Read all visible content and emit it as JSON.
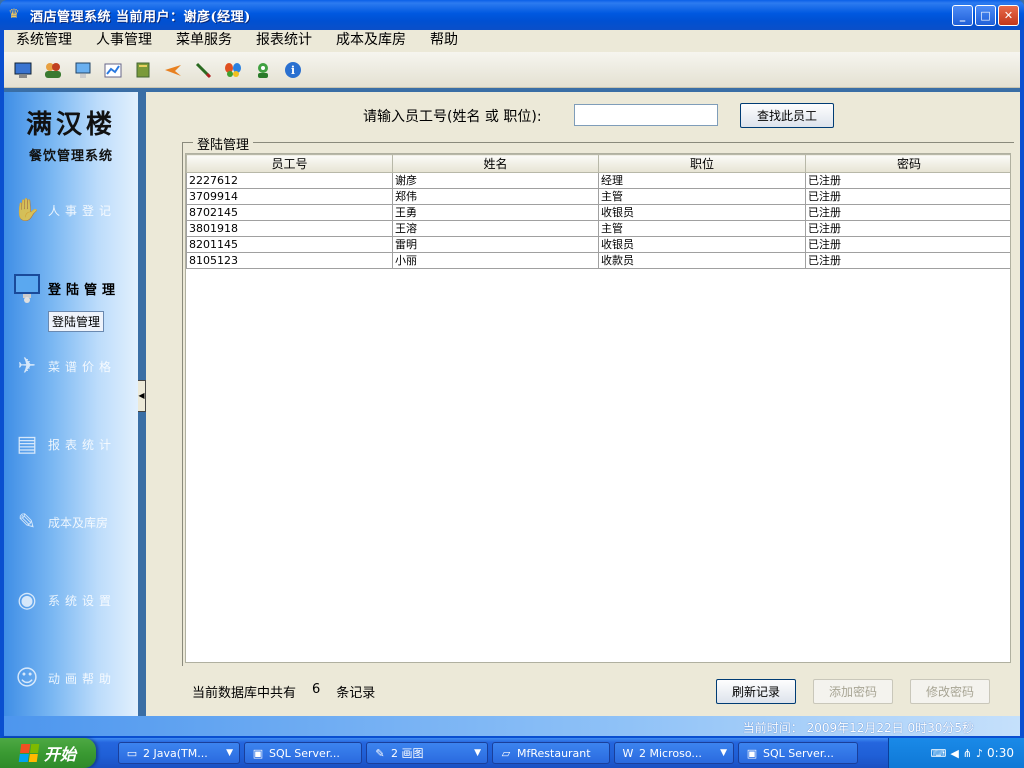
{
  "window": {
    "title": "酒店管理系统  当前用户：谢彦(经理)",
    "minimize": "_",
    "maximize": "□",
    "close": "✕"
  },
  "menu": [
    "系统管理",
    "人事管理",
    "菜单服务",
    "报表统计",
    "成本及库房",
    "帮助"
  ],
  "toolbar_icons": [
    "computer-icon",
    "users-icon",
    "monitor-icon",
    "chart-icon",
    "book-icon",
    "plane-icon",
    "pen-icon",
    "butterfly-icon",
    "user-icon",
    "info-icon"
  ],
  "sidebar": {
    "brand_title": "满汉楼",
    "brand_subtitle": "餐饮管理系统",
    "items": [
      {
        "label": "人事登记",
        "icon": "hand-icon",
        "active": false
      },
      {
        "label": "登陆管理",
        "icon": "monitor-icon",
        "active": true
      },
      {
        "label": "菜谱价格",
        "icon": "bird-icon",
        "active": false
      },
      {
        "label": "报表统计",
        "icon": "document-icon",
        "active": false
      },
      {
        "label": "成本及库房",
        "icon": "pen-icon",
        "active": false
      },
      {
        "label": "系统设置",
        "icon": "disc-icon",
        "active": false
      },
      {
        "label": "动画帮助",
        "icon": "person-icon",
        "active": false
      }
    ],
    "sub_link": "登陆管理"
  },
  "search": {
    "label": "请输入员工号(姓名 或 职位):",
    "value": "",
    "button": "查找此员工"
  },
  "group_title": "登陆管理",
  "table": {
    "columns": [
      "员工号",
      "姓名",
      "职位",
      "密码"
    ],
    "rows": [
      [
        "2227612",
        "谢彦",
        "经理",
        "已注册"
      ],
      [
        "3709914",
        "郑伟",
        "主管",
        "已注册"
      ],
      [
        "8702145",
        "王勇",
        "收银员",
        "已注册"
      ],
      [
        "3801918",
        "王溶",
        "主管",
        "已注册"
      ],
      [
        "8201145",
        "雷明",
        "收银员",
        "已注册"
      ],
      [
        "8105123",
        "小丽",
        "收款员",
        "已注册"
      ]
    ]
  },
  "footer": {
    "count_prefix": "当前数据库中共有",
    "count_value": "6",
    "count_suffix": "条记录",
    "refresh": "刷新记录",
    "add_password": "添加密码",
    "edit_password": "修改密码"
  },
  "status": "当前时间： 2009年12月22日  0时30分5秒",
  "taskbar": {
    "start": "开始",
    "tasks": [
      {
        "label": "2 Java(TM...",
        "icon": "window-icon",
        "arrow": true
      },
      {
        "label": "SQL Server...",
        "icon": "sql-icon",
        "arrow": false
      },
      {
        "label": "2 画图",
        "icon": "paint-icon",
        "arrow": true
      },
      {
        "label": "MfRestaurant",
        "icon": "folder-icon",
        "arrow": false
      },
      {
        "label": "2 Microso...",
        "icon": "word-icon",
        "arrow": true
      },
      {
        "label": "SQL Server...",
        "icon": "sql-icon",
        "arrow": false
      }
    ],
    "clock": "0:30"
  }
}
